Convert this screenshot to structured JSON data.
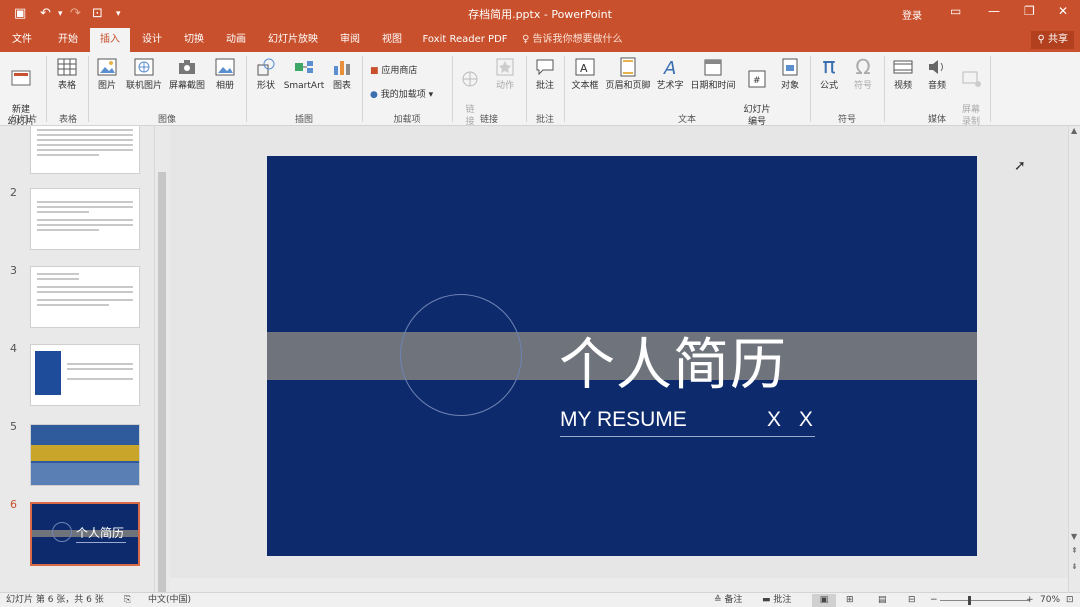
{
  "window": {
    "title": "存档简用.pptx - PowerPoint",
    "login": "登录"
  },
  "tabs": [
    {
      "label": "文件"
    },
    {
      "label": "开始"
    },
    {
      "label": "插入"
    },
    {
      "label": "设计"
    },
    {
      "label": "切换"
    },
    {
      "label": "动画"
    },
    {
      "label": "幻灯片放映"
    },
    {
      "label": "审阅"
    },
    {
      "label": "视图"
    },
    {
      "label": "Foxit Reader PDF"
    }
  ],
  "active_tab": "插入",
  "tell_me": "告诉我你想要做什么",
  "share": "共享",
  "ribbon": {
    "new_slide": "新建\n幻灯片",
    "table": "表格",
    "picture": "图片",
    "online_picture": "联机图片",
    "screenshot": "屏幕截图",
    "album": "相册",
    "shapes": "形状",
    "smartart": "SmartArt",
    "chart": "图表",
    "store": "应用商店",
    "my_addins": "我的加载项",
    "link": "链\n接",
    "action": "动作",
    "comment": "批注",
    "textbox": "文本框",
    "header_footer": "页眉和页脚",
    "wordart": "艺术字",
    "datetime": "日期和时间",
    "slide_number": "幻灯片\n编号",
    "object": "对象",
    "equation": "公式",
    "symbol": "符号",
    "video": "视频",
    "audio": "音频",
    "screen_record": "屏幕\n录制",
    "groups": {
      "slides": "幻灯片",
      "tables": "表格",
      "images": "图像",
      "illustrations": "插图",
      "addins": "加载项",
      "links": "链接",
      "comments": "批注",
      "text": "文本",
      "symbols": "符号",
      "media": "媒体"
    }
  },
  "thumbnails": [
    {
      "number": "2"
    },
    {
      "number": "3"
    },
    {
      "number": "4"
    },
    {
      "number": "5"
    },
    {
      "number": "6"
    }
  ],
  "thumb6_title": "个人简历",
  "slide": {
    "title": "个人简历",
    "subtitle": "MY RESUME",
    "name": "X X"
  },
  "status": {
    "slide_info": "幻灯片 第 6 张，共 6 张",
    "language": "中文(中国)",
    "notes": "备注",
    "comments": "批注",
    "zoom": "70%"
  },
  "colors": {
    "accent": "#c8502c",
    "slide_bg": "#0d2a6d",
    "band": "#6e737c"
  }
}
